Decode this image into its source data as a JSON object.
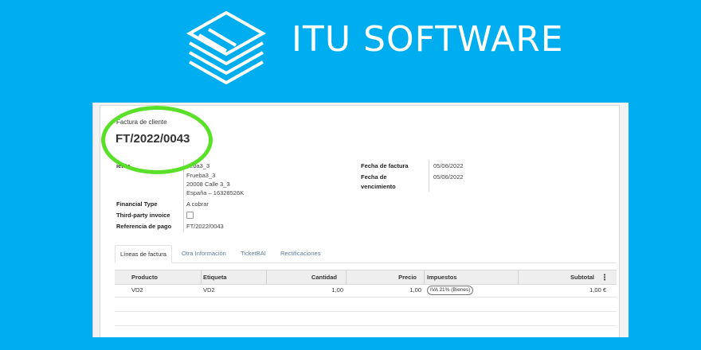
{
  "banner": {
    "brand": "ITU SOFTWARE",
    "background_color": "#00aeef",
    "logo_icon": "stacked-layers-icon"
  },
  "invoice": {
    "doc_label": "Factura de cliente",
    "doc_number": "FT/2022/0043",
    "highlight_color": "#5be02a",
    "customer_label": "Cliente",
    "customer_visible_label": "iente",
    "customer_lines": [
      "Frueba3_3",
      "Frueba3_3",
      "20008 Calle 3_3",
      "España – 16328526K"
    ],
    "customer_line1_visible": "ueba3_3",
    "financial_type_label": "Financial Type",
    "financial_type_value": "A cobrar",
    "third_party_label": "Third-party invoice",
    "third_party_checked": false,
    "payment_ref_label": "Referencia de pago",
    "payment_ref_value": "FT/2022/0043",
    "invoice_date_label": "Fecha de factura",
    "invoice_date_value": "05/06/2022",
    "due_date_label_line1": "Fecha de",
    "due_date_label_line2": "vencimiento",
    "due_date_value": "05/06/2022"
  },
  "tabs": [
    {
      "label": "Líneas de factura",
      "active": true
    },
    {
      "label": "Otra Información",
      "active": false
    },
    {
      "label": "TicketBAI",
      "active": false
    },
    {
      "label": "Rectificaciones",
      "active": false
    }
  ],
  "table": {
    "headers": {
      "product": "Producto",
      "label": "Etiqueta",
      "quantity": "Cantidad",
      "price": "Precio",
      "taxes": "Impuestos",
      "subtotal": "Subtotal"
    },
    "settings_icon": "column-options-icon",
    "rows": [
      {
        "product": "VD2",
        "label": "VD2",
        "quantity": "1,00",
        "price": "1,00",
        "tax": "IVA 21% (Bienes)",
        "subtotal": "1,00 €"
      }
    ]
  }
}
